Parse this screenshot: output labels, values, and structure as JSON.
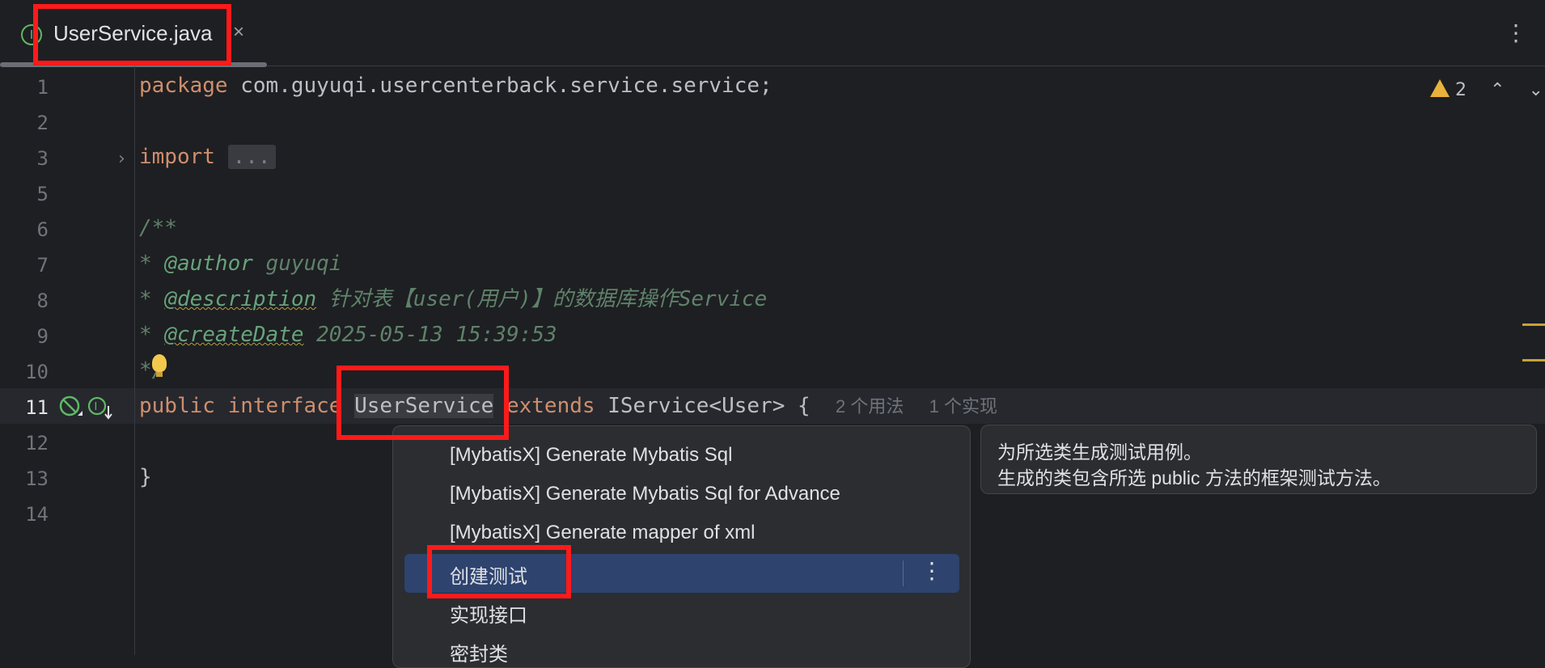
{
  "tab": {
    "file_icon": "interface-file-icon",
    "file_icon_glyph": "I",
    "title": "UserService.java",
    "close_glyph": "×",
    "menu_glyph": "⋮"
  },
  "line_numbers": [
    "1",
    "2",
    "3",
    "5",
    "6",
    "7",
    "8",
    "9",
    "10",
    "11",
    "12",
    "13",
    "14"
  ],
  "code": {
    "l1_kw": "package",
    "l1_text": " com.guyuqi.usercenterback.service.service;",
    "l3_kw": "import",
    "l3_fold": "...",
    "l6": "/**",
    "l7_star": "* ",
    "l7_tag": "@author",
    "l7_val": " guyuqi",
    "l8_star": "* ",
    "l8_tag": "@description",
    "l8_val": " 针对表【user(用户)】的数据库操作Service",
    "l9_star": "* ",
    "l9_tag": "@createDate",
    "l9_val": " 2025-05-13 15:39:53",
    "l10": "*/",
    "l11_kw1": "public",
    "l11_kw2": "interface",
    "l11_name": "UserService",
    "l11_kw3": "extends",
    "l11_rest": " IService<User> {",
    "l11_hint1": "2 个用法",
    "l11_hint2": "1 个实现",
    "l13": "}"
  },
  "warnings": {
    "count": "2",
    "up_glyph": "⌃",
    "down_glyph": "⌄"
  },
  "popup": {
    "items": [
      "[MybatisX] Generate Mybatis Sql",
      "[MybatisX] Generate Mybatis Sql for Advance",
      "[MybatisX] Generate mapper of xml",
      "创建测试",
      "实现接口",
      "密封类"
    ],
    "more_glyph": "⋮"
  },
  "tooltip": {
    "line1": "为所选类生成测试用例。",
    "line2": "生成的类包含所选 public 方法的框架测试方法。"
  },
  "colors": {
    "highlight": "#ff1a1a",
    "selection": "#2e436e",
    "warning": "#e8b23c"
  }
}
